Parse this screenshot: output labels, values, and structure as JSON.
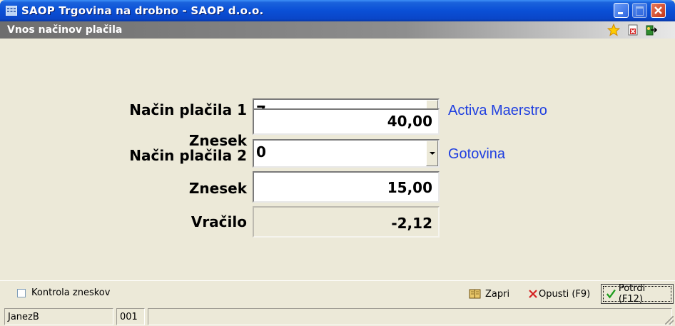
{
  "window": {
    "title": "SAOP Trgovina na drobno - SAOP d.o.o."
  },
  "subheader": {
    "title": "Vnos načinov plačila"
  },
  "form": {
    "method1": {
      "label": "Način plačila 1",
      "code": "7",
      "name": "Activa Maerstro"
    },
    "amount1": {
      "label": "Znesek",
      "value": "40,00"
    },
    "method2": {
      "label": "Način plačila 2",
      "code": "0",
      "name": "Gotovina"
    },
    "amount2": {
      "label": "Znesek",
      "value": "15,00"
    },
    "change": {
      "label": "Vračilo",
      "value": "-2,12"
    }
  },
  "footer": {
    "checkbox_label": "Kontrola zneskov",
    "checkbox_checked": false,
    "zapri_label": "Zapri",
    "opusti_label": "Opusti (F9)",
    "potrdi_label": "Potrdi (F12)"
  },
  "statusbar": {
    "user": "JanezB",
    "code": "001"
  },
  "icons": {
    "favorite": "star-icon",
    "delete": "delete-document-icon",
    "exit": "exit-icon"
  },
  "colors": {
    "title_blue": "#0a46c8",
    "desc_text": "#1f3fe0",
    "background": "#ECE9D8"
  }
}
